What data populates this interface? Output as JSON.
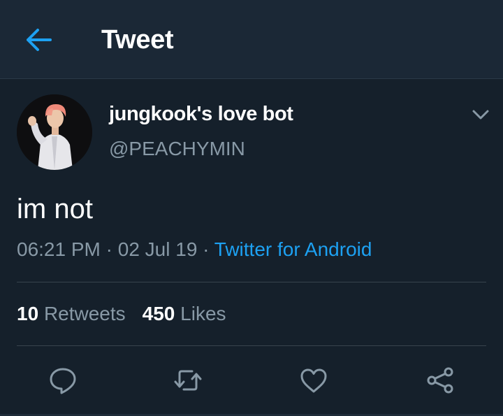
{
  "header": {
    "title": "Tweet",
    "back_icon": "arrow-left-icon"
  },
  "tweet": {
    "author": {
      "display_name": "jungkook's love bot",
      "handle": "@PEACHYMIN",
      "avatar": "avatar-photo"
    },
    "text": "im not",
    "time": "06:21 PM",
    "date": "02 Jul 19",
    "separator": "·",
    "source": "Twitter for Android",
    "stats": {
      "retweets_count": "10",
      "retweets_label": "Retweets",
      "likes_count": "450",
      "likes_label": "Likes"
    }
  },
  "actions": [
    "reply-icon",
    "retweet-icon",
    "like-icon",
    "share-icon"
  ],
  "colors": {
    "background": "#15202b",
    "header": "#1b2836",
    "accent": "#1da1f2",
    "secondary_text": "#8899a6",
    "divider": "#38444d"
  }
}
